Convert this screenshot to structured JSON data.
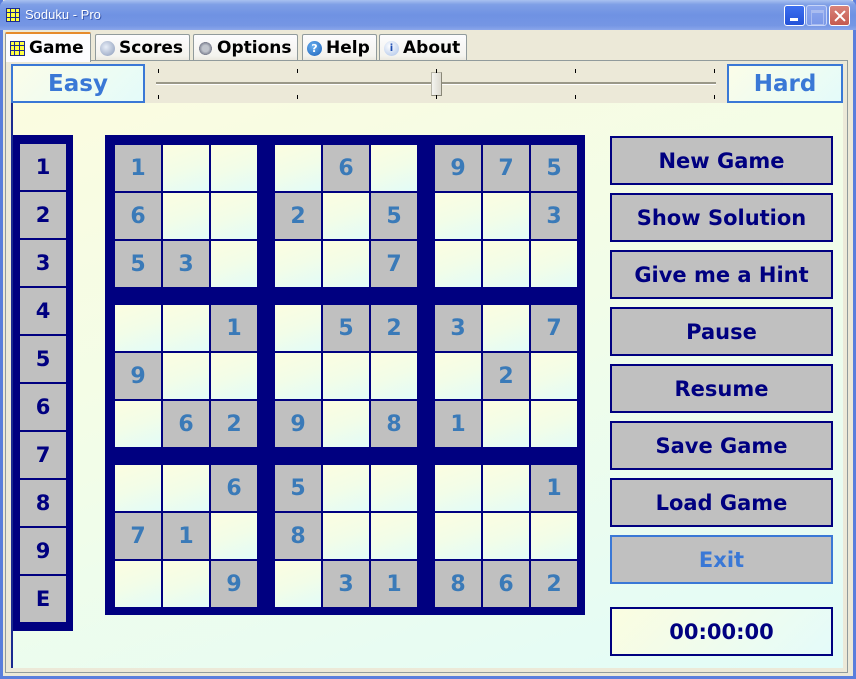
{
  "window": {
    "title": "Soduku - Pro",
    "controls": [
      "minimize",
      "maximize",
      "close"
    ]
  },
  "tabs": [
    {
      "label": "Game",
      "icon": "grid-icon",
      "selected": true
    },
    {
      "label": "Scores",
      "icon": "scores-icon",
      "selected": false
    },
    {
      "label": "Options",
      "icon": "gears-icon",
      "selected": false
    },
    {
      "label": "Help",
      "icon": "help-icon",
      "selected": false
    },
    {
      "label": "About",
      "icon": "info-icon",
      "selected": false
    }
  ],
  "difficulty": {
    "min_label": "Easy",
    "max_label": "Hard",
    "slider": {
      "min": 0,
      "max": 4,
      "value": 2,
      "ticks": 5
    }
  },
  "numpad": {
    "keys": [
      "1",
      "2",
      "3",
      "4",
      "5",
      "6",
      "7",
      "8",
      "9",
      "E"
    ]
  },
  "board": {
    "rows": [
      [
        "1",
        "",
        "",
        "",
        "6",
        "",
        "9",
        "7",
        "5"
      ],
      [
        "6",
        "",
        "",
        "2",
        "",
        "5",
        "",
        "",
        "3"
      ],
      [
        "5",
        "3",
        "",
        "",
        "",
        "7",
        "",
        "",
        ""
      ],
      [
        "",
        "",
        "1",
        "",
        "5",
        "2",
        "3",
        "",
        "7"
      ],
      [
        "9",
        "",
        "",
        "",
        "",
        "",
        "",
        "2",
        ""
      ],
      [
        "",
        "6",
        "2",
        "9",
        "",
        "8",
        "1",
        "",
        ""
      ],
      [
        "",
        "",
        "6",
        "5",
        "",
        "",
        "",
        "",
        "1"
      ],
      [
        "7",
        "1",
        "",
        "8",
        "",
        "",
        "",
        "",
        ""
      ],
      [
        "",
        "",
        "9",
        "",
        "3",
        "1",
        "8",
        "6",
        "2"
      ]
    ]
  },
  "actions": [
    {
      "label": "New Game",
      "hovered": false
    },
    {
      "label": "Show Solution",
      "hovered": false
    },
    {
      "label": "Give me a Hint",
      "hovered": false
    },
    {
      "label": "Pause",
      "hovered": false
    },
    {
      "label": "Resume",
      "hovered": false
    },
    {
      "label": "Save Game",
      "hovered": false
    },
    {
      "label": "Load Game",
      "hovered": false
    },
    {
      "label": "Exit",
      "hovered": true
    }
  ],
  "timer": {
    "value": "00:00:00"
  },
  "colors": {
    "navy": "#000080",
    "given_cell": "#c0c0c0",
    "digit": "#3a7ab8",
    "accent": "#3a78d6"
  }
}
